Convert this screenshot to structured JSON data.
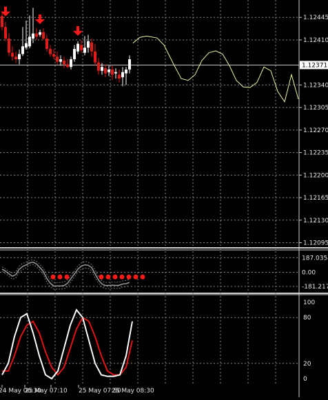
{
  "chart_data": {
    "type": "candlestick",
    "colors": {
      "background": "#000000",
      "grid": "#8a8a8a",
      "axis_text": "#e6e6e6",
      "bull_candle": "#ffffff",
      "bear_candle": "#e11a1a",
      "signal_arrow": "#ff1a1a",
      "projection_line": "#f2f2a0",
      "price_line": "#c8c8c8",
      "cci_line": "#9a9a9a",
      "cci_dots": "#ff1a1a",
      "stoch_main": "#ffffff",
      "stoch_signal": "#e01515"
    },
    "main_panel": {
      "ylim": [
        1.12087,
        1.12472
      ],
      "y_ticks": [
        "1.12445",
        "1.12410",
        "1.12340",
        "1.12305",
        "1.12270",
        "1.12235",
        "1.12200",
        "1.12165",
        "1.12130",
        "1.12095"
      ],
      "current_price": "1.12371",
      "x_labels": [
        "24 May 06:30",
        "25 May 07:10",
        "25 May 07:50",
        "25 May 08:30"
      ],
      "candles": [
        {
          "o": 1.12447,
          "h": 1.12452,
          "l": 1.12425,
          "c": 1.1243
        },
        {
          "o": 1.1243,
          "h": 1.12438,
          "l": 1.12408,
          "c": 1.12412
        },
        {
          "o": 1.12412,
          "h": 1.1242,
          "l": 1.12385,
          "c": 1.1239
        },
        {
          "o": 1.1239,
          "h": 1.124,
          "l": 1.12378,
          "c": 1.12384
        },
        {
          "o": 1.12384,
          "h": 1.12392,
          "l": 1.12374,
          "c": 1.1238
        },
        {
          "o": 1.1238,
          "h": 1.12395,
          "l": 1.12372,
          "c": 1.12388
        },
        {
          "o": 1.12388,
          "h": 1.1243,
          "l": 1.12385,
          "c": 1.124
        },
        {
          "o": 1.12398,
          "h": 1.1244,
          "l": 1.12395,
          "c": 1.12405
        },
        {
          "o": 1.124,
          "h": 1.12448,
          "l": 1.12397,
          "c": 1.12415
        },
        {
          "o": 1.12412,
          "h": 1.1246,
          "l": 1.12405,
          "c": 1.1242
        },
        {
          "o": 1.1242,
          "h": 1.12428,
          "l": 1.1241,
          "c": 1.12415
        },
        {
          "o": 1.12418,
          "h": 1.12426,
          "l": 1.12415,
          "c": 1.12422
        },
        {
          "o": 1.12422,
          "h": 1.12428,
          "l": 1.1241,
          "c": 1.12412
        },
        {
          "o": 1.12412,
          "h": 1.12418,
          "l": 1.12392,
          "c": 1.12396
        },
        {
          "o": 1.12396,
          "h": 1.12402,
          "l": 1.12384,
          "c": 1.12388
        },
        {
          "o": 1.12388,
          "h": 1.12396,
          "l": 1.1238,
          "c": 1.12384
        },
        {
          "o": 1.12384,
          "h": 1.12392,
          "l": 1.12372,
          "c": 1.12376
        },
        {
          "o": 1.12376,
          "h": 1.12386,
          "l": 1.1237,
          "c": 1.1238
        },
        {
          "o": 1.12378,
          "h": 1.12384,
          "l": 1.12366,
          "c": 1.12372
        },
        {
          "o": 1.12372,
          "h": 1.1238,
          "l": 1.12366,
          "c": 1.12368
        },
        {
          "o": 1.12368,
          "h": 1.12384,
          "l": 1.12364,
          "c": 1.1238
        },
        {
          "o": 1.1238,
          "h": 1.12402,
          "l": 1.12376,
          "c": 1.12396
        },
        {
          "o": 1.12392,
          "h": 1.12408,
          "l": 1.12388,
          "c": 1.12404
        },
        {
          "o": 1.12402,
          "h": 1.1241,
          "l": 1.1239,
          "c": 1.12394
        },
        {
          "o": 1.1239,
          "h": 1.12416,
          "l": 1.12386,
          "c": 1.12398
        },
        {
          "o": 1.12398,
          "h": 1.12418,
          "l": 1.1239,
          "c": 1.12408
        },
        {
          "o": 1.12406,
          "h": 1.12412,
          "l": 1.12384,
          "c": 1.12392
        },
        {
          "o": 1.12392,
          "h": 1.12404,
          "l": 1.1237,
          "c": 1.12375
        },
        {
          "o": 1.12375,
          "h": 1.12382,
          "l": 1.12356,
          "c": 1.12362
        },
        {
          "o": 1.12362,
          "h": 1.12374,
          "l": 1.12356,
          "c": 1.12368
        },
        {
          "o": 1.12366,
          "h": 1.12372,
          "l": 1.12352,
          "c": 1.12358
        },
        {
          "o": 1.1236,
          "h": 1.1237,
          "l": 1.12354,
          "c": 1.12364
        },
        {
          "o": 1.12364,
          "h": 1.1237,
          "l": 1.12348,
          "c": 1.12356
        },
        {
          "o": 1.12358,
          "h": 1.12366,
          "l": 1.1235,
          "c": 1.1236
        },
        {
          "o": 1.12356,
          "h": 1.12364,
          "l": 1.12344,
          "c": 1.1235
        },
        {
          "o": 1.12352,
          "h": 1.12368,
          "l": 1.12338,
          "c": 1.1236
        },
        {
          "o": 1.12358,
          "h": 1.12368,
          "l": 1.1234,
          "c": 1.12364
        },
        {
          "o": 1.12364,
          "h": 1.12386,
          "l": 1.12358,
          "c": 1.1238
        }
      ],
      "down_arrow_at": [
        1,
        11,
        22
      ],
      "projection": [
        [
          38,
          1.12405
        ],
        [
          40,
          1.12414
        ],
        [
          42,
          1.12416
        ],
        [
          45,
          1.12413
        ],
        [
          47,
          1.12402
        ],
        [
          50,
          1.1237
        ],
        [
          52,
          1.1235
        ],
        [
          54,
          1.12347
        ],
        [
          56,
          1.12356
        ],
        [
          58,
          1.12378
        ],
        [
          60,
          1.1239
        ],
        [
          62,
          1.12393
        ],
        [
          64,
          1.12388
        ],
        [
          66,
          1.1237
        ],
        [
          68,
          1.12347
        ],
        [
          70,
          1.12337
        ],
        [
          72,
          1.12336
        ],
        [
          74,
          1.12344
        ],
        [
          76,
          1.12368
        ],
        [
          78,
          1.12362
        ],
        [
          80,
          1.1233
        ],
        [
          82,
          1.12314
        ],
        [
          84,
          1.12356
        ],
        [
          86,
          1.12318
        ]
      ]
    },
    "cci_panel": {
      "ylim": [
        -260,
        260
      ],
      "y_ticks": [
        "187.0354",
        "0.00",
        "-181.217"
      ],
      "main": [
        40,
        15,
        -20,
        -50,
        -30,
        40,
        75,
        95,
        120,
        130,
        105,
        60,
        10,
        -80,
        -140,
        -175,
        -175,
        -175,
        -170,
        -140,
        -80,
        -20,
        40,
        80,
        95,
        90,
        60,
        -20,
        -100,
        -150,
        -170,
        -168,
        -165,
        -168,
        -165,
        -150,
        -145,
        -130
      ],
      "upper": [
        70,
        45,
        10,
        -10,
        5,
        80,
        115,
        130,
        150,
        160,
        140,
        100,
        50,
        -30,
        -90,
        -130,
        -130,
        -130,
        -125,
        -95,
        -40,
        20,
        80,
        120,
        140,
        130,
        100,
        30,
        -60,
        -110,
        -130,
        -128,
        -125,
        -128,
        -125,
        -110,
        -105,
        -90
      ],
      "lower": [
        10,
        -15,
        -50,
        -90,
        -70,
        0,
        35,
        60,
        90,
        100,
        70,
        20,
        -30,
        -130,
        -190,
        -215,
        -215,
        -215,
        -210,
        -185,
        -120,
        -60,
        0,
        40,
        55,
        50,
        20,
        -70,
        -140,
        -190,
        -210,
        -208,
        -205,
        -208,
        -205,
        -190,
        -185,
        -170
      ],
      "dots_at": [
        15,
        17,
        19,
        29,
        31,
        33,
        35,
        37,
        39,
        41
      ]
    },
    "stoch_panel": {
      "ylim": [
        0,
        100
      ],
      "y_ticks": [
        "100",
        "80",
        "20",
        "0"
      ],
      "k": [
        5,
        20,
        55,
        80,
        85,
        60,
        30,
        5,
        0,
        10,
        40,
        70,
        90,
        80,
        50,
        20,
        5,
        3,
        3,
        5,
        30,
        75
      ],
      "d": [
        10,
        10,
        30,
        55,
        70,
        75,
        60,
        35,
        15,
        5,
        15,
        40,
        65,
        80,
        75,
        55,
        30,
        10,
        5,
        5,
        15,
        50
      ]
    }
  }
}
